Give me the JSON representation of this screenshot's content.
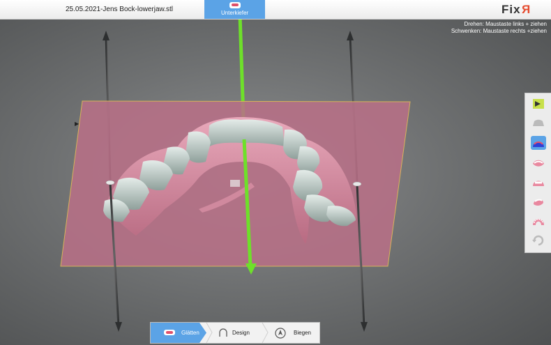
{
  "window": {
    "file_title": "25.05.2021-Jens Bock-lowerjaw.stl"
  },
  "mode_tab": {
    "label": "Unterkiefer",
    "icon": "lower-jaw-icon",
    "color": "#5ba3e6"
  },
  "logo": {
    "text_main": "Fix",
    "text_accent": "R",
    "accent_color": "#e54b2e"
  },
  "hints": {
    "rotate": "Drehen: Maustaste links + ziehen",
    "pan": "Schwenken: Maustaste rechts +ziehen"
  },
  "toolbar": {
    "tools": [
      {
        "name": "cut-plane-tool",
        "icon": "arrow-plane-icon",
        "active": false
      },
      {
        "name": "base-tool",
        "icon": "jaw-base-icon",
        "active": false
      },
      {
        "name": "trim-tool",
        "icon": "arch-trim-icon",
        "active": true
      },
      {
        "name": "view-side-tool",
        "icon": "jaw-side-icon",
        "active": false
      },
      {
        "name": "view-front-tool",
        "icon": "jaw-front-icon",
        "active": false
      },
      {
        "name": "view-angle-tool",
        "icon": "jaw-angle-icon",
        "active": false
      },
      {
        "name": "view-top-tool",
        "icon": "jaw-top-icon",
        "active": false
      },
      {
        "name": "reset-view-tool",
        "icon": "rotate-icon",
        "active": false
      }
    ]
  },
  "workflow": {
    "steps": [
      {
        "label": "Glätten",
        "icon": "jaw-icon",
        "active": true
      },
      {
        "label": "Design",
        "icon": "arch-icon",
        "active": false
      },
      {
        "label": "Biegen",
        "icon": "pin-icon",
        "active": false
      }
    ]
  },
  "colors": {
    "accent": "#5ba3e6",
    "plane": "#b76f86",
    "axis_green": "#6ee02a",
    "gum": "#d98fa6",
    "teeth": "#c8d2cf"
  }
}
